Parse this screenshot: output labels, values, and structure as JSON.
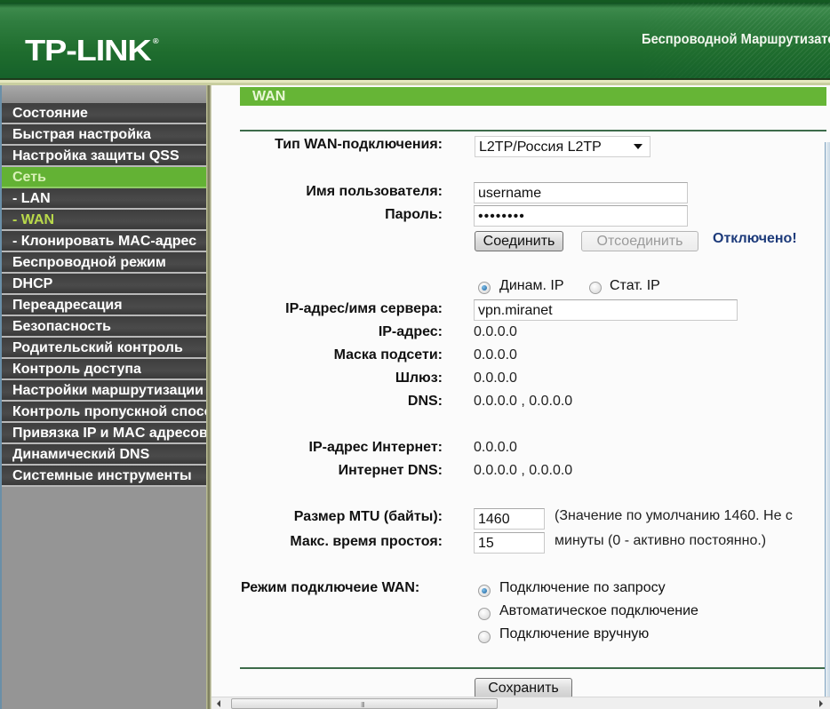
{
  "header": {
    "logo": "TP-LINK",
    "logo_mark": "®",
    "subtitle": "Беспроводной Маршрутизатор"
  },
  "sidebar": {
    "items": [
      {
        "label": "Состояние",
        "state": "normal"
      },
      {
        "label": "Быстрая настройка",
        "state": "normal"
      },
      {
        "label": "Настройка защиты QSS",
        "state": "normal"
      },
      {
        "label": "Сеть",
        "state": "active"
      },
      {
        "label": "- LAN",
        "state": "normal"
      },
      {
        "label": "- WAN",
        "state": "current"
      },
      {
        "label": "- Клонировать MAC-адрес",
        "state": "normal"
      },
      {
        "label": "Беспроводной режим",
        "state": "normal"
      },
      {
        "label": "DHCP",
        "state": "normal"
      },
      {
        "label": "Переадресация",
        "state": "normal"
      },
      {
        "label": "Безопасность",
        "state": "normal"
      },
      {
        "label": "Родительский контроль",
        "state": "normal"
      },
      {
        "label": "Контроль доступа",
        "state": "normal"
      },
      {
        "label": "Настройки маршрутизации",
        "state": "normal"
      },
      {
        "label": "Контроль пропускной способности",
        "state": "normal"
      },
      {
        "label": "Привязка IP и MAC адресов",
        "state": "normal"
      },
      {
        "label": "Динамический DNS",
        "state": "normal"
      },
      {
        "label": "Системные инструменты",
        "state": "normal"
      }
    ]
  },
  "page": {
    "title": "WAN",
    "wan_type": {
      "label": "Тип WAN-подключения:",
      "value": "L2TP/Россия L2TP"
    },
    "username": {
      "label": "Имя пользователя:",
      "value": "username"
    },
    "password": {
      "label": "Пароль:",
      "value": "••••••••"
    },
    "connect_button": "Соединить",
    "disconnect_button": "Отсоединить",
    "status": "Отключено!",
    "ip_mode": {
      "options": [
        {
          "label": "Динам. IP",
          "checked": true
        },
        {
          "label": "Стат. IP",
          "checked": false
        }
      ]
    },
    "server": {
      "label": "IP-адрес/имя сервера:",
      "value": "vpn.miranet"
    },
    "ip": {
      "label": "IP-адрес:",
      "value": "0.0.0.0"
    },
    "mask": {
      "label": "Маска подсети:",
      "value": "0.0.0.0"
    },
    "gateway": {
      "label": "Шлюз:",
      "value": "0.0.0.0"
    },
    "dns": {
      "label": "DNS:",
      "value": "0.0.0.0 , 0.0.0.0"
    },
    "internet_ip": {
      "label": "IP-адрес Интернет:",
      "value": "0.0.0.0"
    },
    "internet_dns": {
      "label": "Интернет DNS:",
      "value": "0.0.0.0 , 0.0.0.0"
    },
    "mtu": {
      "label": "Размер MTU (байты):",
      "value": "1460",
      "note": "(Значение по умолчанию 1460. Не с"
    },
    "idle": {
      "label": "Макс. время простоя:",
      "value": "15",
      "note": "минуты (0 - активно постоянно.)"
    },
    "connection_mode": {
      "label": "Режим подключеие WAN:",
      "options": [
        {
          "label": "Подключение по запросу",
          "checked": true
        },
        {
          "label": "Автоматическое подключение",
          "checked": false
        },
        {
          "label": "Подключение вручную",
          "checked": false
        }
      ]
    },
    "save_button": "Сохранить"
  },
  "scrollbar": {
    "grip": "III"
  }
}
